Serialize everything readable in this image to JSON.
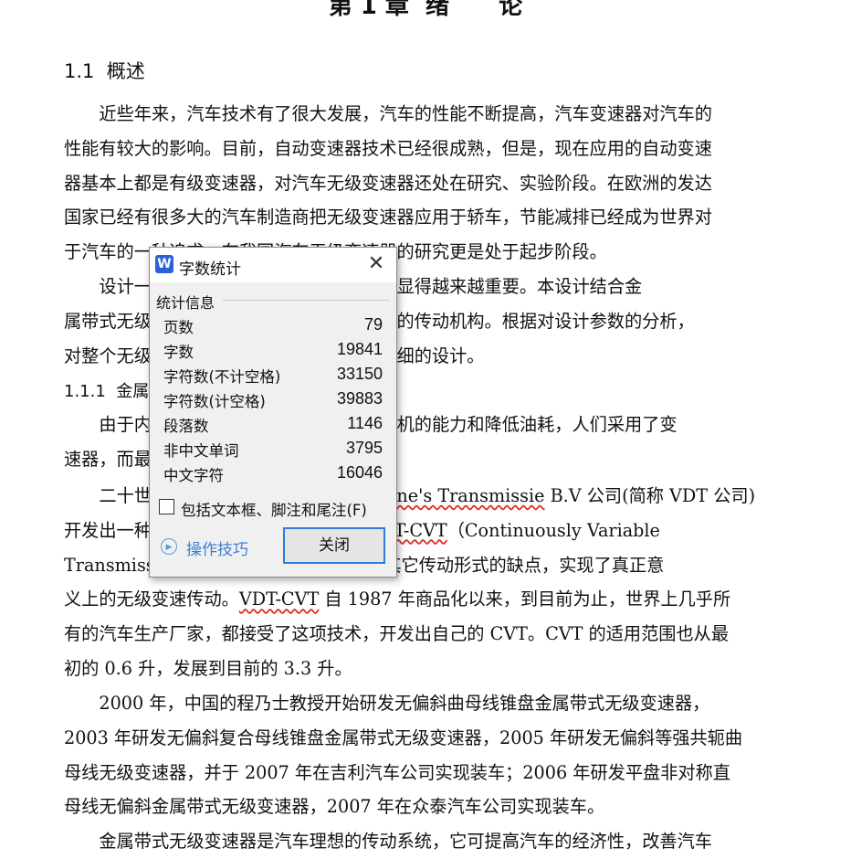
{
  "document": {
    "chapter_title": "第 1 章  绪      论",
    "section_1": "1.1  概述",
    "para1": [
      "近些年来，汽车技术有了很大发展，汽车的性能不断提高，汽车变速器对汽车的",
      "性能有较大的影响。目前，自动变速器技术已经很成熟，但是，现在应用的自动变速",
      "器基本上都是有级变速器，对汽车无级变速器还处在研究、实验阶段。在欧洲的发达",
      "国家已经有很多大的汽车制造商把无级变速器应用于轿车，节能减排已经成为世界对",
      "于汽车的一种追求，在我国汽车无级变速器的研究更是处于起步阶段。"
    ],
    "para2": [
      "设计一种适合于汽车的无级变速器已经显得越来越重要。本设计结合金",
      "属带式无级变速器的特点，设计无级变速器的传动机构。根据对设计参数的分析，",
      "对整个无级变速器的结构和传动方式进行详细的设计。"
    ],
    "section_1_1": "1.1.1  金属带式无级变速器",
    "para3": [
      "由于内燃机的特性，为了充分发挥内燃机的能力和降低油耗，人们采用了变",
      "速器，而最理想的是无级变速器。"
    ],
    "para4_line1_a": "二十世纪七十年代，荷兰的 Van ",
    "para4_line1_b": "Doorne's Transmissie",
    "para4_line1_c": " B.V 公司(简称 VDT 公司)",
    "para4_line2_a": "开发出一种金属带式无级变速器，称为 ",
    "para4_line2_b": "VDT-CVT",
    "para4_line2_c": "（Continuously Variable",
    "para4_line3": "Transmission），这种变速器克服了以前其它传动形式的缺点，实现了真正意",
    "para4_line4_a": "义上的无级变速传动。",
    "para4_line4_b": "VDT-CVT",
    "para4_line4_c": " 自 1987 年商品化以来，到目前为止，世界上几乎所",
    "para4_line5": "有的汽车生产厂家，都接受了这项技术，开发出自己的 CVT。CVT 的适用范围也从最",
    "para4_line6": "初的 0.6 升，发展到目前的 3.3 升。",
    "para5": [
      "2000 年，中国的程乃士教授开始研发无偏斜曲母线锥盘金属带式无级变速器，",
      "2003 年研发无偏斜复合母线锥盘金属带式无级变速器，2005 年研发无偏斜等强共轭曲",
      "母线无级变速器，并于 2007 年在吉利汽车公司实现装车；2006 年研发平盘非对称直",
      "母线无偏斜金属带式无级变速器，2007 年在众泰汽车公司实现装车。"
    ],
    "para6": [
      "金属带式无级变速器是汽车理想的传动系统，它可提高汽车的经济性，改善汽车"
    ]
  },
  "dialog": {
    "app_icon_letter": "W",
    "title": "字数统计",
    "group_label": "统计信息",
    "stats": [
      {
        "label": "页数",
        "value": "79"
      },
      {
        "label": "字数",
        "value": "19841"
      },
      {
        "label": "字符数(不计空格)",
        "value": "33150"
      },
      {
        "label": "字符数(计空格)",
        "value": "39883"
      },
      {
        "label": "段落数",
        "value": "1146"
      },
      {
        "label": "非中文单词",
        "value": "3795"
      },
      {
        "label": "中文字符",
        "value": "16046"
      }
    ],
    "include_label": "包括文本框、脚注和尾注(F)",
    "tips_label": "操作技巧",
    "close_label": "关闭",
    "accent_color": "#2f7be0"
  }
}
